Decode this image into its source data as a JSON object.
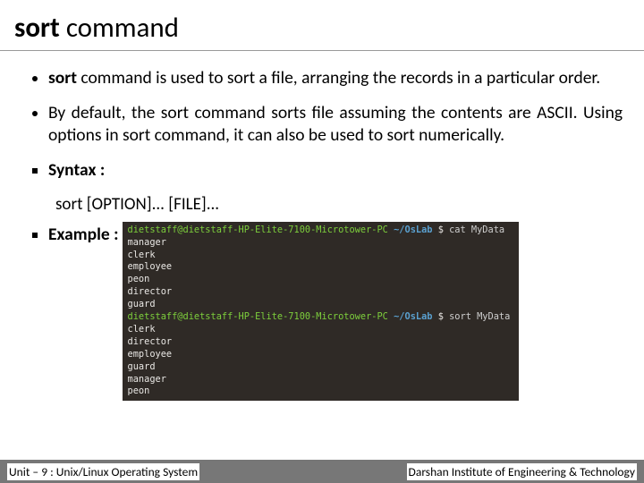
{
  "title": {
    "bold": "sort",
    "rest": " command"
  },
  "bullets": {
    "b1_bold": "sort",
    "b1_rest": " command is used to sort a file, arranging the records in a particular order.",
    "b2": "By default, the sort command sorts file assuming the contents are ASCII. Using options in sort command, it can also be used to sort numerically.",
    "syntax_label": "Syntax :",
    "syntax_line": "sort [OPTION]... [FILE]...",
    "example_label": "Example :"
  },
  "terminal": {
    "prompt_user": "dietstaff@dietstaff-HP-Elite-7100-Microtower-PC",
    "prompt_path": "~/OsLab",
    "dollar": "$",
    "cmd1": "cat MyData",
    "cmd2": "sort MyData",
    "out1": [
      "manager",
      "clerk",
      "employee",
      "peon",
      "director",
      "guard"
    ],
    "out2": [
      "clerk",
      "director",
      "employee",
      "guard",
      "manager",
      "peon"
    ]
  },
  "footer": {
    "left": "Unit – 9  : Unix/Linux Operating System",
    "right": "Darshan Institute of Engineering & Technology"
  }
}
